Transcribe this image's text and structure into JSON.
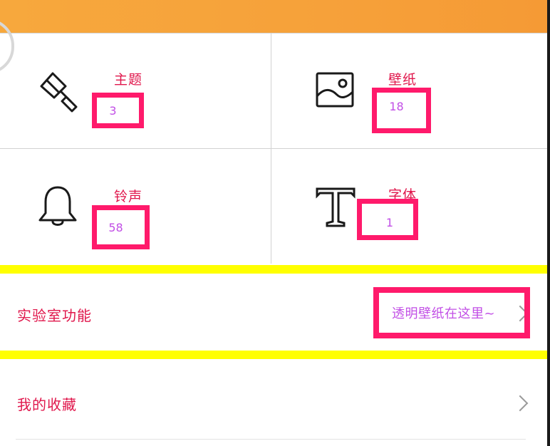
{
  "categories": [
    {
      "id": "theme",
      "label": "主题",
      "count": "3",
      "icon": "paintbrush-icon"
    },
    {
      "id": "wallpaper",
      "label": "壁纸",
      "count": "18",
      "icon": "image-icon"
    },
    {
      "id": "ringtone",
      "label": "铃声",
      "count": "58",
      "icon": "bell-icon"
    },
    {
      "id": "font",
      "label": "字体",
      "count": "1",
      "icon": "font-icon"
    }
  ],
  "lab": {
    "label": "实验室功能",
    "hint": "透明壁纸在这里~"
  },
  "favorites": {
    "label": "我的收藏"
  },
  "colors": {
    "header": "#f7a83d",
    "label_red": "#e0174c",
    "count_purple": "#c24fe6",
    "highlight_pink": "#ff1a6b",
    "highlight_yellow": "#ffff00"
  }
}
